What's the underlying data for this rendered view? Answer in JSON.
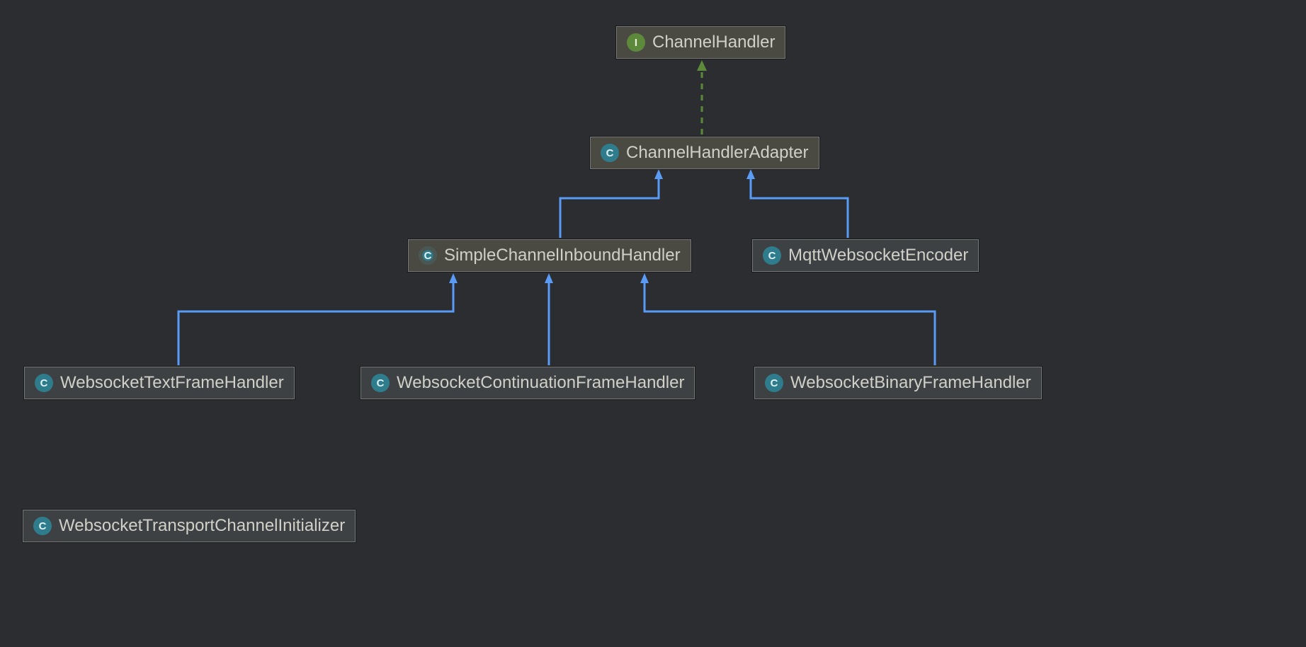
{
  "diagram": {
    "nodes": {
      "channelHandler": {
        "label": "ChannelHandler",
        "kind": "I"
      },
      "channelHandlerAdapter": {
        "label": "ChannelHandlerAdapter",
        "kind": "C"
      },
      "simpleChannelInboundHandler": {
        "label": "SimpleChannelInboundHandler",
        "kind": "C"
      },
      "mqttWebsocketEncoder": {
        "label": "MqttWebsocketEncoder",
        "kind": "C"
      },
      "websocketTextFrameHandler": {
        "label": "WebsocketTextFrameHandler",
        "kind": "C"
      },
      "websocketContinuationFrameHandler": {
        "label": "WebsocketContinuationFrameHandler",
        "kind": "C"
      },
      "websocketBinaryFrameHandler": {
        "label": "WebsocketBinaryFrameHandler",
        "kind": "C"
      },
      "websocketTransportChannelInitializer": {
        "label": "WebsocketTransportChannelInitializer",
        "kind": "C"
      }
    },
    "edges": [
      {
        "from": "channelHandlerAdapter",
        "to": "channelHandler",
        "style": "implements"
      },
      {
        "from": "simpleChannelInboundHandler",
        "to": "channelHandlerAdapter",
        "style": "extends"
      },
      {
        "from": "mqttWebsocketEncoder",
        "to": "channelHandlerAdapter",
        "style": "extends"
      },
      {
        "from": "websocketTextFrameHandler",
        "to": "simpleChannelInboundHandler",
        "style": "extends"
      },
      {
        "from": "websocketContinuationFrameHandler",
        "to": "simpleChannelInboundHandler",
        "style": "extends"
      },
      {
        "from": "websocketBinaryFrameHandler",
        "to": "simpleChannelInboundHandler",
        "style": "extends"
      }
    ],
    "colors": {
      "extends": "#5a9bf6",
      "implements": "#5c8a3a",
      "background": "#2b2d30"
    }
  }
}
